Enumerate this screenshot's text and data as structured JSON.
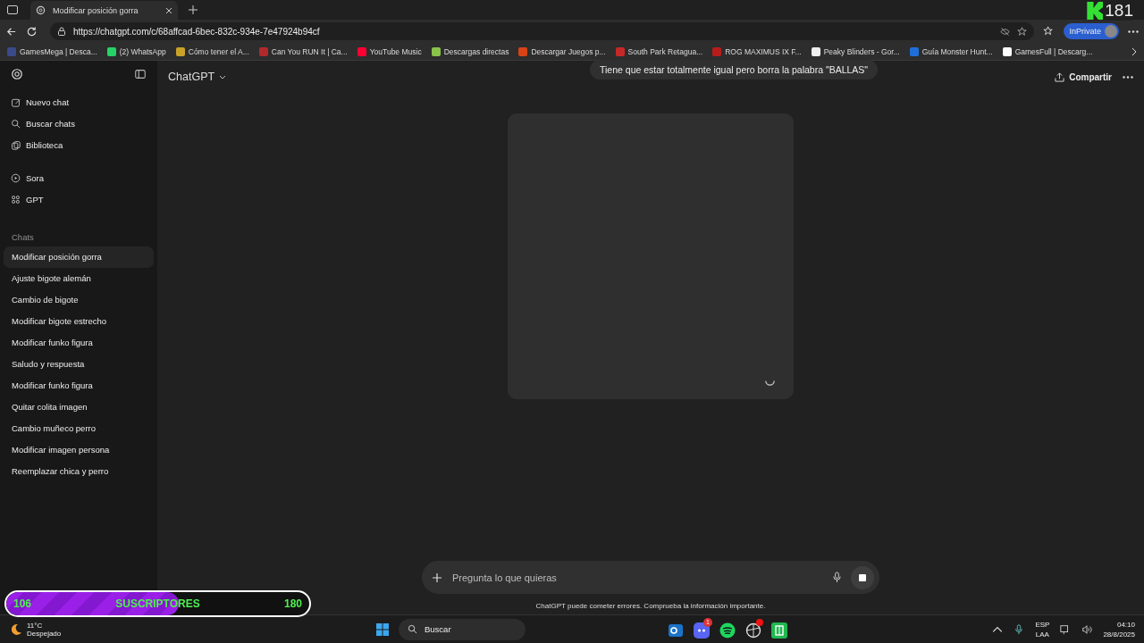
{
  "browser": {
    "tab_title": "Modificar posición gorra",
    "url": "https://chatgpt.com/c/68affcad-6bec-832c-934e-7e47924b94cf",
    "profile": "InPrivate",
    "bookmarks": [
      {
        "label": "GamesMega | Desca...",
        "color": "#3a4a8a"
      },
      {
        "label": "(2) WhatsApp",
        "color": "#25d366"
      },
      {
        "label": "Cómo tener el A...",
        "color": "#c9a227"
      },
      {
        "label": "Can You RUN It | Ca...",
        "color": "#b02a2a"
      },
      {
        "label": "YouTube Music",
        "color": "#ff0033"
      },
      {
        "label": "Descargas directas",
        "color": "#8bc34a"
      },
      {
        "label": "Descargar Juegos p...",
        "color": "#d84315"
      },
      {
        "label": "South Park Retagua...",
        "color": "#c62828"
      },
      {
        "label": "ROG MAXIMUS IX F...",
        "color": "#b71c1c"
      },
      {
        "label": "Peaky Blinders - Gor...",
        "color": "#eeeeee"
      },
      {
        "label": "Guía Monster Hunt...",
        "color": "#1e6fd9"
      },
      {
        "label": "GamesFull | Descarg...",
        "color": "#ffffff"
      }
    ]
  },
  "stream_counter": "181",
  "sidebar": {
    "nav": [
      {
        "kind": "new-chat",
        "label": "Nuevo chat"
      },
      {
        "kind": "search",
        "label": "Buscar chats"
      },
      {
        "kind": "library",
        "label": "Biblioteca"
      },
      {
        "kind": "sora",
        "label": "Sora"
      },
      {
        "kind": "gpt",
        "label": "GPT"
      }
    ],
    "section_title": "Chats",
    "chats": [
      {
        "label": "Modificar posición gorra",
        "selected": true
      },
      {
        "label": "Ajuste bigote alemán",
        "selected": false
      },
      {
        "label": "Cambio de bigote",
        "selected": false
      },
      {
        "label": "Modificar bigote estrecho",
        "selected": false
      },
      {
        "label": "Modificar funko figura",
        "selected": false
      },
      {
        "label": "Saludo y respuesta",
        "selected": false
      },
      {
        "label": "Modificar funko figura",
        "selected": false
      },
      {
        "label": "Quitar colita imagen",
        "selected": false
      },
      {
        "label": "Cambio muñeco perro",
        "selected": false
      },
      {
        "label": "Modificar imagen persona",
        "selected": false
      },
      {
        "label": "Reemplazar chica y perro",
        "selected": false
      }
    ]
  },
  "header": {
    "model": "ChatGPT",
    "share": "Compartir"
  },
  "user_message": "Tiene que estar totalmente igual pero borra la palabra \"BALLAS\"",
  "composer": {
    "placeholder": "Pregunta lo que quieras"
  },
  "disclaimer": "ChatGPT puede cometer errores. Comprueba la información importante.",
  "subscriber_bar": {
    "current": "106",
    "label": "SUSCRIPTORES",
    "goal": "180",
    "level": 0.57
  },
  "taskbar": {
    "temperature": "11°C",
    "weather": "Despejado",
    "search": "Buscar",
    "apps": [
      {
        "kind": "outlook"
      },
      {
        "kind": "discord",
        "badge": "1"
      },
      {
        "kind": "spotify"
      },
      {
        "kind": "circle"
      },
      {
        "kind": "sheet"
      }
    ],
    "language": "ESP",
    "layout": "LAA",
    "time": "04:10",
    "date": "28/8/2025"
  }
}
